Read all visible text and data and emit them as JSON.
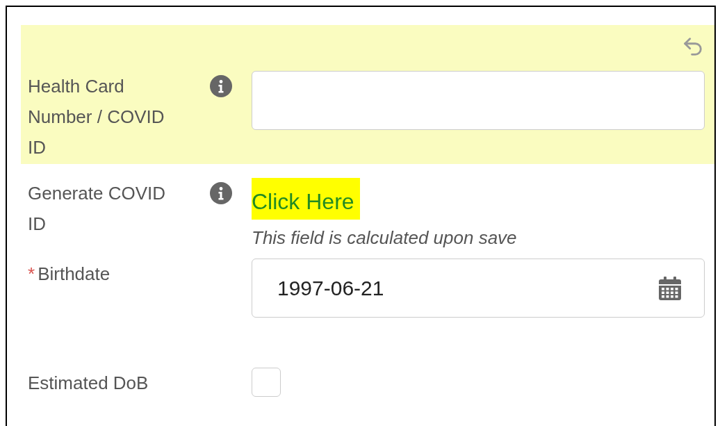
{
  "fields": [
    {
      "kind": "text",
      "label": "Health Card Number / COVID ID",
      "changed": true,
      "info": true
    },
    {
      "kind": "link",
      "label": "Generate COVID ID",
      "changed": false,
      "info": true,
      "link": "Click Here",
      "note": "This field is calculated upon save"
    },
    {
      "kind": "date",
      "label": "Birthdate",
      "changed": false,
      "info": false,
      "required_mark": "*",
      "value": "1997-06-21"
    },
    {
      "kind": "checkbox",
      "label": "Estimated DoB",
      "changed": false,
      "info": false,
      "checked": false
    }
  ]
}
